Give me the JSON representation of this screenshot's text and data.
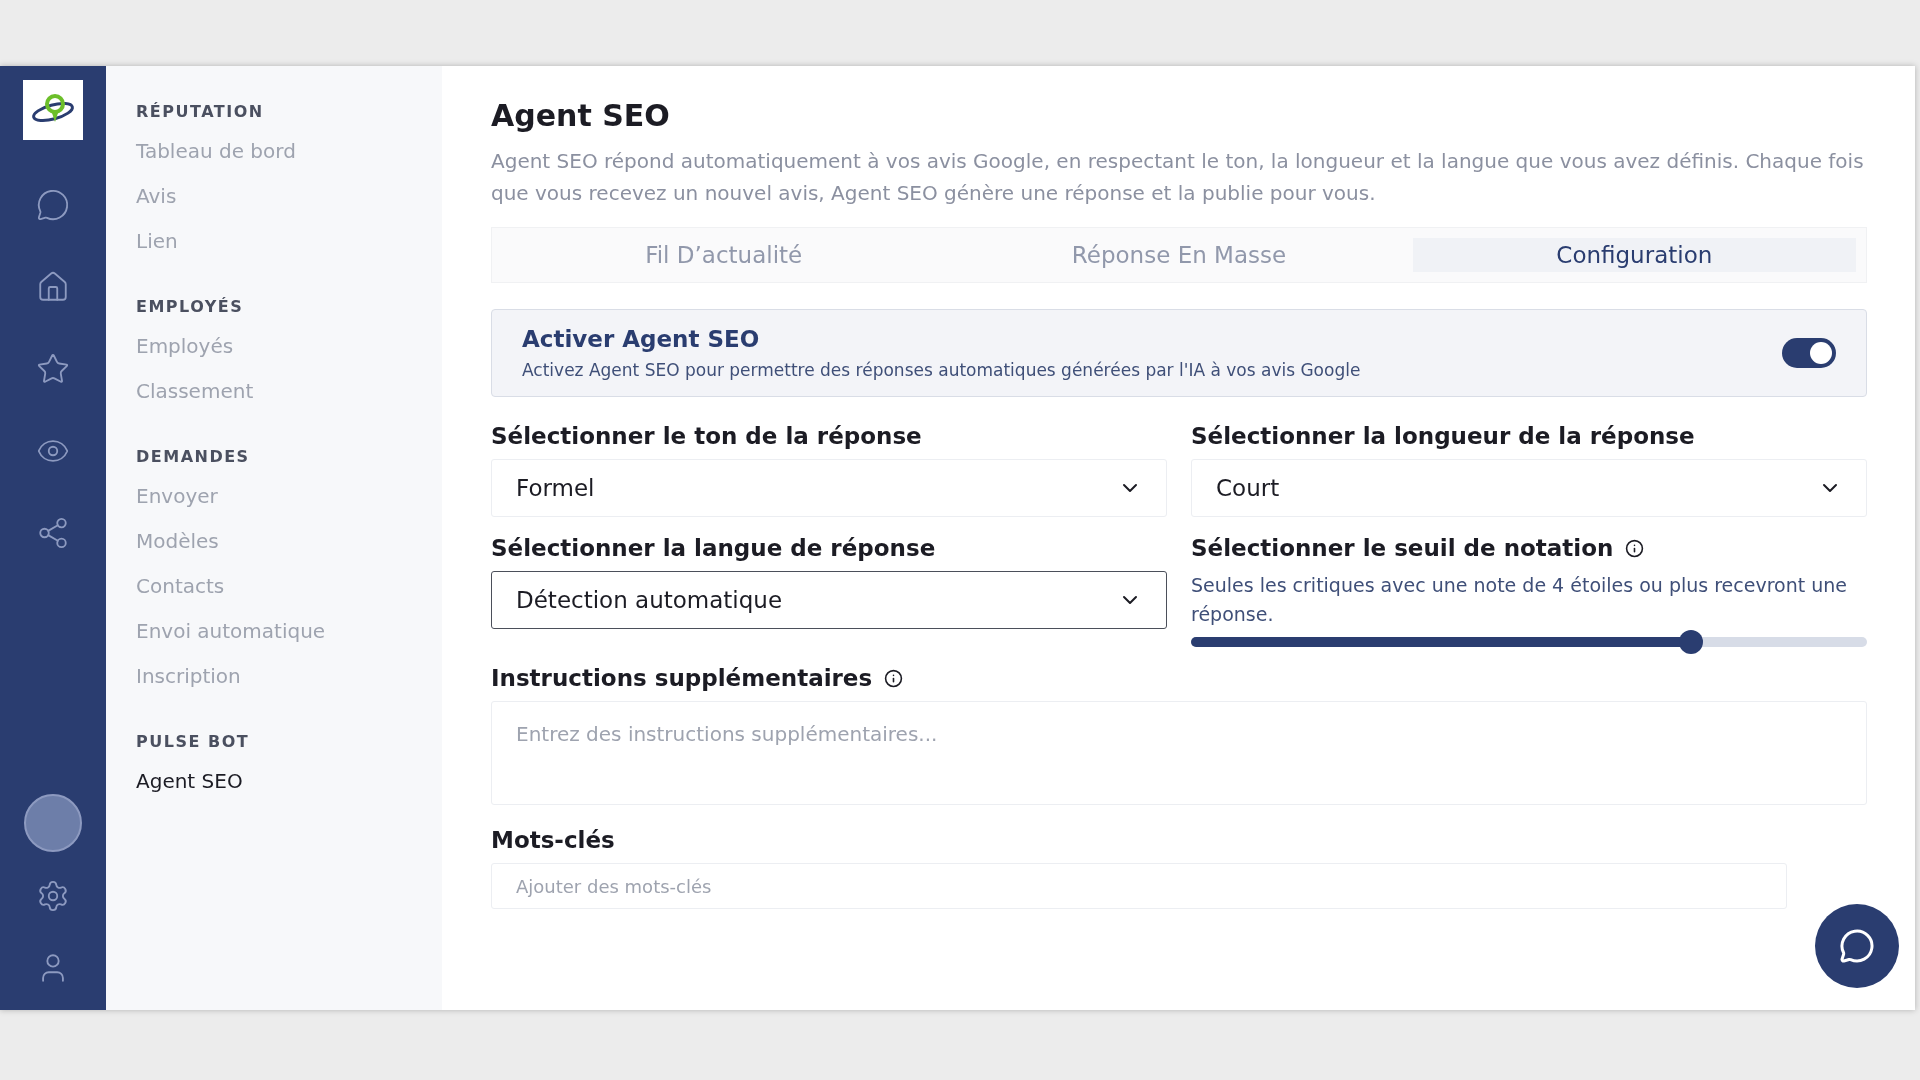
{
  "nav": {
    "sections": [
      {
        "heading": "RÉPUTATION",
        "items": [
          {
            "label": "Tableau de bord",
            "selected": false
          },
          {
            "label": "Avis",
            "selected": false
          },
          {
            "label": "Lien",
            "selected": false
          }
        ]
      },
      {
        "heading": "EMPLOYÉS",
        "items": [
          {
            "label": "Employés",
            "selected": false
          },
          {
            "label": "Classement",
            "selected": false
          }
        ]
      },
      {
        "heading": "DEMANDES",
        "items": [
          {
            "label": "Envoyer",
            "selected": false
          },
          {
            "label": "Modèles",
            "selected": false
          },
          {
            "label": "Contacts",
            "selected": false
          },
          {
            "label": "Envoi automatique",
            "selected": false
          },
          {
            "label": "Inscription",
            "selected": false
          }
        ]
      },
      {
        "heading": "PULSE BOT",
        "items": [
          {
            "label": "Agent SEO",
            "selected": true
          }
        ]
      }
    ]
  },
  "page": {
    "title": "Agent SEO",
    "description": "Agent SEO répond automatiquement à vos avis Google, en respectant le ton, la longueur et la langue que vous avez définis. Chaque fois que vous recevez un nouvel avis, Agent SEO génère une réponse et la publie pour vous."
  },
  "tabs": [
    {
      "label": "Fil D’actualité",
      "selected": false
    },
    {
      "label": "Réponse En Masse",
      "selected": false
    },
    {
      "label": "Configuration",
      "selected": true
    }
  ],
  "activation": {
    "title": "Activer Agent SEO",
    "description": "Activez Agent SEO pour permettre des réponses automatiques générées par l'IA à vos avis Google",
    "on": true
  },
  "selects": [
    {
      "label": "Sélectionner le ton de la réponse",
      "value": "Formel",
      "focused": false
    },
    {
      "label": "Sélectionner la longueur de la réponse",
      "value": "Court",
      "focused": false
    },
    {
      "label": "Sélectionner la langue de réponse",
      "value": "Détection automatique",
      "focused": true
    }
  ],
  "threshold": {
    "label": "Sélectionner le seuil de notation",
    "hint": "Seules les critiques avec une note de 4 étoiles ou plus recevront une réponse.",
    "level": 0.74
  },
  "instructions": {
    "label": "Instructions supplémentaires",
    "placeholder": "Entrez des instructions supplémentaires..."
  },
  "keywords": {
    "label": "Mots-clés",
    "placeholder": "Ajouter des mots-clés"
  }
}
